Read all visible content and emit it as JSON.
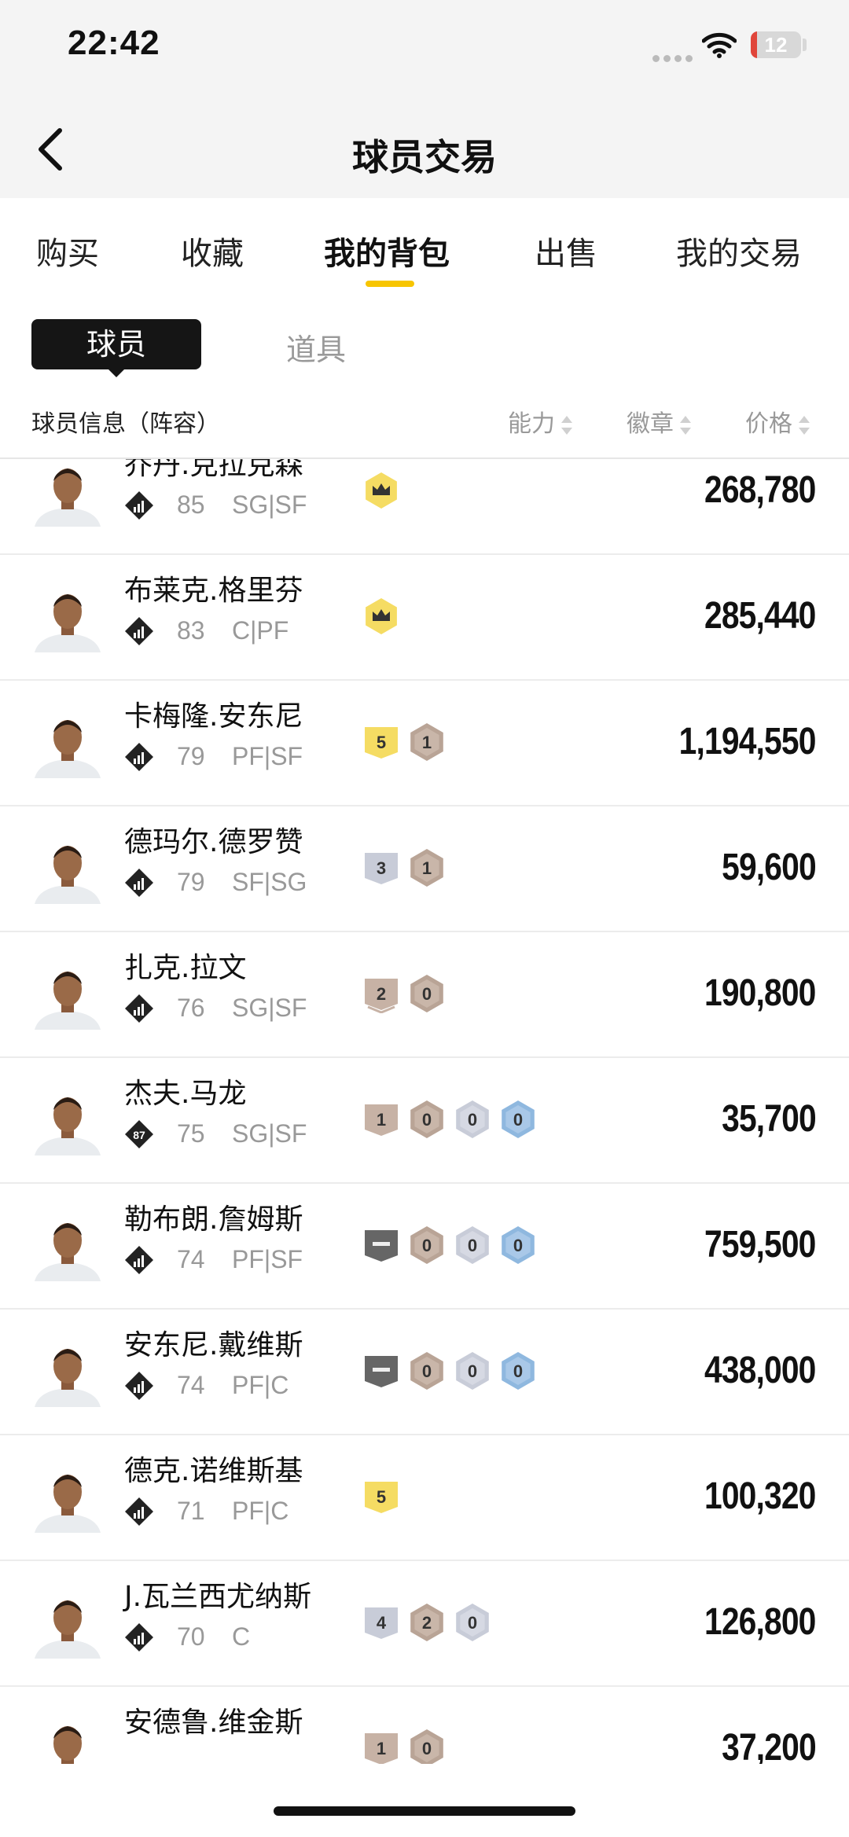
{
  "status_bar": {
    "time": "22:42",
    "battery": "12",
    "battery_level": 0.12
  },
  "nav": {
    "title": "球员交易"
  },
  "tabs": [
    {
      "label": "购买",
      "active": false
    },
    {
      "label": "收藏",
      "active": false
    },
    {
      "label": "我的背包",
      "active": true
    },
    {
      "label": "出售",
      "active": false
    },
    {
      "label": "我的交易",
      "active": false
    }
  ],
  "segments": {
    "player": "球员",
    "props": "道具"
  },
  "columns": {
    "info": "球员信息（阵容）",
    "ability": "能力",
    "badge": "徽章",
    "price": "价格"
  },
  "colors": {
    "accent": "#f7c500",
    "gold_badge": "#f5dc63",
    "silver_badge": "#c8ccd8",
    "bronze_badge": "#c7b2a5",
    "blue_badge": "#8fb8df",
    "dark_badge": "#666666"
  },
  "players": [
    {
      "name": "乔丹.克拉克森",
      "rating": "85",
      "position": "SG|SF",
      "price": "268,780",
      "badges": [
        {
          "kind": "crown",
          "label": ""
        }
      ]
    },
    {
      "name": "布莱克.格里芬",
      "rating": "83",
      "position": "C|PF",
      "price": "285,440",
      "badges": [
        {
          "kind": "crown",
          "label": ""
        }
      ]
    },
    {
      "name": "卡梅隆.安东尼",
      "rating": "79",
      "position": "PF|SF",
      "price": "1,194,550",
      "badges": [
        {
          "kind": "gold",
          "label": "5"
        },
        {
          "kind": "bronze-hex",
          "label": "1"
        }
      ]
    },
    {
      "name": "德玛尔.德罗赞",
      "rating": "79",
      "position": "SF|SG",
      "price": "59,600",
      "badges": [
        {
          "kind": "silver",
          "label": "3"
        },
        {
          "kind": "bronze-hex",
          "label": "1"
        }
      ]
    },
    {
      "name": "扎克.拉文",
      "rating": "76",
      "position": "SG|SF",
      "price": "190,800",
      "badges": [
        {
          "kind": "bronze-chevron",
          "label": "2"
        },
        {
          "kind": "bronze-hex",
          "label": "0"
        }
      ]
    },
    {
      "name": "杰夫.马龙",
      "rating": "75",
      "position": "SG|SF",
      "price": "35,700",
      "rating_icon_text": "87",
      "badges": [
        {
          "kind": "bronze",
          "label": "1"
        },
        {
          "kind": "bronze-hex",
          "label": "0"
        },
        {
          "kind": "silver-hex",
          "label": "0"
        },
        {
          "kind": "blue-hex",
          "label": "0"
        }
      ]
    },
    {
      "name": "勒布朗.詹姆斯",
      "rating": "74",
      "position": "PF|SF",
      "price": "759,500",
      "badges": [
        {
          "kind": "dark",
          "label": ""
        },
        {
          "kind": "bronze-hex",
          "label": "0"
        },
        {
          "kind": "silver-hex",
          "label": "0"
        },
        {
          "kind": "blue-hex",
          "label": "0"
        }
      ]
    },
    {
      "name": "安东尼.戴维斯",
      "rating": "74",
      "position": "PF|C",
      "price": "438,000",
      "badges": [
        {
          "kind": "dark",
          "label": ""
        },
        {
          "kind": "bronze-hex",
          "label": "0"
        },
        {
          "kind": "silver-hex",
          "label": "0"
        },
        {
          "kind": "blue-hex",
          "label": "0"
        }
      ]
    },
    {
      "name": "德克.诺维斯基",
      "rating": "71",
      "position": "PF|C",
      "price": "100,320",
      "badges": [
        {
          "kind": "gold",
          "label": "5"
        }
      ]
    },
    {
      "name": "J.瓦兰西尤纳斯",
      "rating": "70",
      "position": "C",
      "price": "126,800",
      "badges": [
        {
          "kind": "silver",
          "label": "4"
        },
        {
          "kind": "bronze-hex",
          "label": "2"
        },
        {
          "kind": "silver-hex",
          "label": "0"
        }
      ]
    },
    {
      "name": "安德鲁.维金斯",
      "rating": "",
      "position": "",
      "price": "37,200",
      "badges": [
        {
          "kind": "bronze",
          "label": "1"
        },
        {
          "kind": "bronze-hex",
          "label": "0"
        }
      ]
    }
  ]
}
